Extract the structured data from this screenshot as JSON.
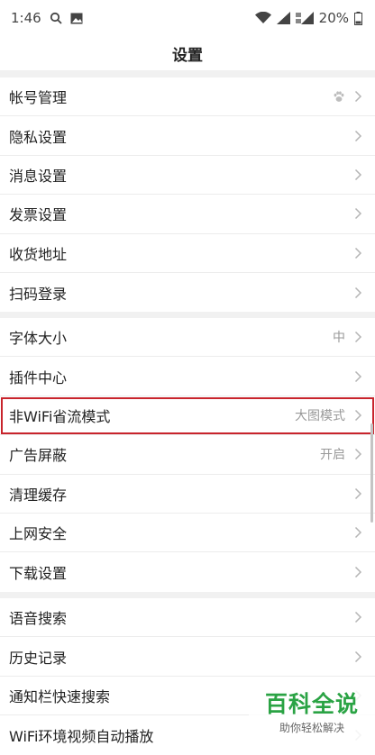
{
  "status_bar": {
    "time": "1:46",
    "battery": "20%",
    "icons": [
      "search-icon",
      "image-icon",
      "wifi-icon",
      "signal-icon",
      "signal-4g-icon",
      "battery-icon"
    ]
  },
  "header": {
    "title": "设置"
  },
  "groups": [
    [
      {
        "label": "帐号管理",
        "value": "",
        "icon": "paw-icon"
      },
      {
        "label": "隐私设置",
        "value": ""
      },
      {
        "label": "消息设置",
        "value": ""
      },
      {
        "label": "发票设置",
        "value": ""
      },
      {
        "label": "收货地址",
        "value": ""
      },
      {
        "label": "扫码登录",
        "value": ""
      }
    ],
    [
      {
        "label": "字体大小",
        "value": "中"
      },
      {
        "label": "插件中心",
        "value": ""
      },
      {
        "label": "非WiFi省流模式",
        "value": "大图模式",
        "highlighted": true
      },
      {
        "label": "广告屏蔽",
        "value": "开启"
      },
      {
        "label": "清理缓存",
        "value": ""
      },
      {
        "label": "上网安全",
        "value": ""
      },
      {
        "label": "下载设置",
        "value": ""
      }
    ],
    [
      {
        "label": "语音搜索",
        "value": ""
      },
      {
        "label": "历史记录",
        "value": ""
      },
      {
        "label": "通知栏快速搜索",
        "value": ""
      },
      {
        "label": "WiFi环境视频自动播放",
        "value": ""
      }
    ]
  ],
  "watermark": {
    "title": "百科全说",
    "subtitle": "助你轻松解决"
  },
  "colors": {
    "highlight_border": "#c8242c",
    "watermark_green": "#2aa344",
    "chevron": "#b5b5b5"
  }
}
